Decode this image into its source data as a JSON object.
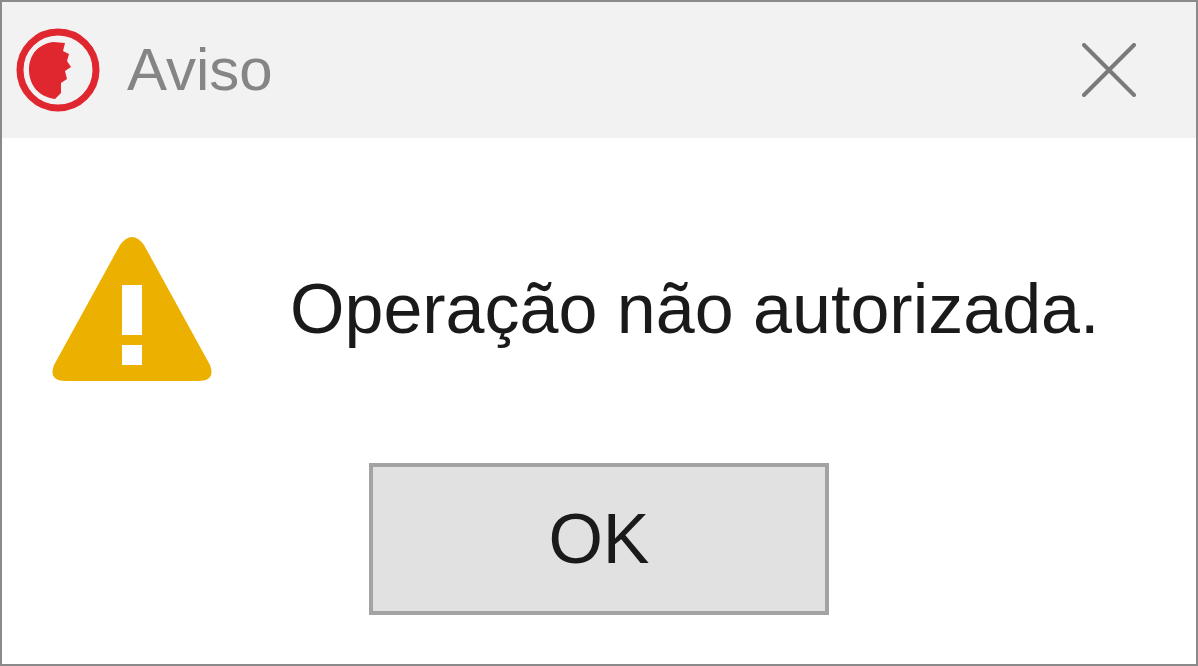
{
  "window": {
    "title": "Aviso"
  },
  "message": "Operação não autorizada.",
  "buttons": [
    "OK"
  ]
}
